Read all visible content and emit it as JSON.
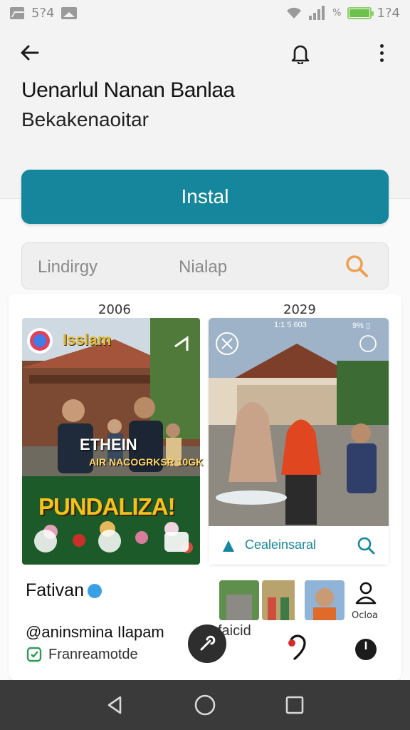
{
  "status": {
    "time_left": "5?4",
    "time_right": "1?4",
    "signal_percent": "%"
  },
  "app": {
    "title": "Uenarlul Nanan Banlaa",
    "subtitle": "Bekakenaoitar",
    "install_label": "Instal"
  },
  "search": {
    "left_text": "Lindirgy",
    "middle_text": "Nialap",
    "icon": "search-icon"
  },
  "screenshots": {
    "years": [
      "2006",
      "2029"
    ],
    "first": {
      "banner": "Isslam",
      "text1": "ETHEIN",
      "text2": "AIR NACOGRKSR 10GK",
      "big": "PUNDALIZA!"
    },
    "second": {
      "status_time": "1:1 5 603",
      "status_pct": "9% ▯",
      "footer_label": "Cealeinsaral"
    }
  },
  "profile": {
    "name": "Fativan",
    "handle": "@aninsmina Ilapam",
    "handle_suffix": "faicid",
    "meta": "Franreamotde",
    "person_label": "Ocloa"
  },
  "colors": {
    "accent": "#16869c",
    "status_battery": "#6dc24b",
    "search_icon": "#f0a050"
  }
}
